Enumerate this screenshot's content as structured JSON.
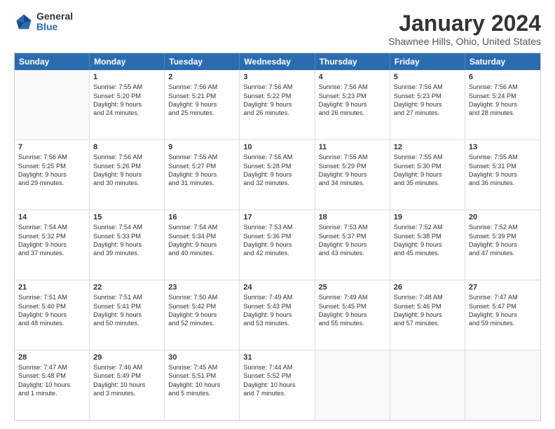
{
  "logo": {
    "general": "General",
    "blue": "Blue"
  },
  "title": "January 2024",
  "subtitle": "Shawnee Hills, Ohio, United States",
  "headers": [
    "Sunday",
    "Monday",
    "Tuesday",
    "Wednesday",
    "Thursday",
    "Friday",
    "Saturday"
  ],
  "weeks": [
    [
      {
        "day": "",
        "lines": []
      },
      {
        "day": "1",
        "lines": [
          "Sunrise: 7:55 AM",
          "Sunset: 5:20 PM",
          "Daylight: 9 hours",
          "and 24 minutes."
        ]
      },
      {
        "day": "2",
        "lines": [
          "Sunrise: 7:56 AM",
          "Sunset: 5:21 PM",
          "Daylight: 9 hours",
          "and 25 minutes."
        ]
      },
      {
        "day": "3",
        "lines": [
          "Sunrise: 7:56 AM",
          "Sunset: 5:22 PM",
          "Daylight: 9 hours",
          "and 26 minutes."
        ]
      },
      {
        "day": "4",
        "lines": [
          "Sunrise: 7:56 AM",
          "Sunset: 5:23 PM",
          "Daylight: 9 hours",
          "and 26 minutes."
        ]
      },
      {
        "day": "5",
        "lines": [
          "Sunrise: 7:56 AM",
          "Sunset: 5:23 PM",
          "Daylight: 9 hours",
          "and 27 minutes."
        ]
      },
      {
        "day": "6",
        "lines": [
          "Sunrise: 7:56 AM",
          "Sunset: 5:24 PM",
          "Daylight: 9 hours",
          "and 28 minutes."
        ]
      }
    ],
    [
      {
        "day": "7",
        "lines": [
          "Sunrise: 7:56 AM",
          "Sunset: 5:25 PM",
          "Daylight: 9 hours",
          "and 29 minutes."
        ]
      },
      {
        "day": "8",
        "lines": [
          "Sunrise: 7:56 AM",
          "Sunset: 5:26 PM",
          "Daylight: 9 hours",
          "and 30 minutes."
        ]
      },
      {
        "day": "9",
        "lines": [
          "Sunrise: 7:55 AM",
          "Sunset: 5:27 PM",
          "Daylight: 9 hours",
          "and 31 minutes."
        ]
      },
      {
        "day": "10",
        "lines": [
          "Sunrise: 7:55 AM",
          "Sunset: 5:28 PM",
          "Daylight: 9 hours",
          "and 32 minutes."
        ]
      },
      {
        "day": "11",
        "lines": [
          "Sunrise: 7:55 AM",
          "Sunset: 5:29 PM",
          "Daylight: 9 hours",
          "and 34 minutes."
        ]
      },
      {
        "day": "12",
        "lines": [
          "Sunrise: 7:55 AM",
          "Sunset: 5:30 PM",
          "Daylight: 9 hours",
          "and 35 minutes."
        ]
      },
      {
        "day": "13",
        "lines": [
          "Sunrise: 7:55 AM",
          "Sunset: 5:31 PM",
          "Daylight: 9 hours",
          "and 36 minutes."
        ]
      }
    ],
    [
      {
        "day": "14",
        "lines": [
          "Sunrise: 7:54 AM",
          "Sunset: 5:32 PM",
          "Daylight: 9 hours",
          "and 37 minutes."
        ]
      },
      {
        "day": "15",
        "lines": [
          "Sunrise: 7:54 AM",
          "Sunset: 5:33 PM",
          "Daylight: 9 hours",
          "and 39 minutes."
        ]
      },
      {
        "day": "16",
        "lines": [
          "Sunrise: 7:54 AM",
          "Sunset: 5:34 PM",
          "Daylight: 9 hours",
          "and 40 minutes."
        ]
      },
      {
        "day": "17",
        "lines": [
          "Sunrise: 7:53 AM",
          "Sunset: 5:36 PM",
          "Daylight: 9 hours",
          "and 42 minutes."
        ]
      },
      {
        "day": "18",
        "lines": [
          "Sunrise: 7:53 AM",
          "Sunset: 5:37 PM",
          "Daylight: 9 hours",
          "and 43 minutes."
        ]
      },
      {
        "day": "19",
        "lines": [
          "Sunrise: 7:52 AM",
          "Sunset: 5:38 PM",
          "Daylight: 9 hours",
          "and 45 minutes."
        ]
      },
      {
        "day": "20",
        "lines": [
          "Sunrise: 7:52 AM",
          "Sunset: 5:39 PM",
          "Daylight: 9 hours",
          "and 47 minutes."
        ]
      }
    ],
    [
      {
        "day": "21",
        "lines": [
          "Sunrise: 7:51 AM",
          "Sunset: 5:40 PM",
          "Daylight: 9 hours",
          "and 48 minutes."
        ]
      },
      {
        "day": "22",
        "lines": [
          "Sunrise: 7:51 AM",
          "Sunset: 5:41 PM",
          "Daylight: 9 hours",
          "and 50 minutes."
        ]
      },
      {
        "day": "23",
        "lines": [
          "Sunrise: 7:50 AM",
          "Sunset: 5:42 PM",
          "Daylight: 9 hours",
          "and 52 minutes."
        ]
      },
      {
        "day": "24",
        "lines": [
          "Sunrise: 7:49 AM",
          "Sunset: 5:43 PM",
          "Daylight: 9 hours",
          "and 53 minutes."
        ]
      },
      {
        "day": "25",
        "lines": [
          "Sunrise: 7:49 AM",
          "Sunset: 5:45 PM",
          "Daylight: 9 hours",
          "and 55 minutes."
        ]
      },
      {
        "day": "26",
        "lines": [
          "Sunrise: 7:48 AM",
          "Sunset: 5:46 PM",
          "Daylight: 9 hours",
          "and 57 minutes."
        ]
      },
      {
        "day": "27",
        "lines": [
          "Sunrise: 7:47 AM",
          "Sunset: 5:47 PM",
          "Daylight: 9 hours",
          "and 59 minutes."
        ]
      }
    ],
    [
      {
        "day": "28",
        "lines": [
          "Sunrise: 7:47 AM",
          "Sunset: 5:48 PM",
          "Daylight: 10 hours",
          "and 1 minute."
        ]
      },
      {
        "day": "29",
        "lines": [
          "Sunrise: 7:46 AM",
          "Sunset: 5:49 PM",
          "Daylight: 10 hours",
          "and 3 minutes."
        ]
      },
      {
        "day": "30",
        "lines": [
          "Sunrise: 7:45 AM",
          "Sunset: 5:51 PM",
          "Daylight: 10 hours",
          "and 5 minutes."
        ]
      },
      {
        "day": "31",
        "lines": [
          "Sunrise: 7:44 AM",
          "Sunset: 5:52 PM",
          "Daylight: 10 hours",
          "and 7 minutes."
        ]
      },
      {
        "day": "",
        "lines": []
      },
      {
        "day": "",
        "lines": []
      },
      {
        "day": "",
        "lines": []
      }
    ]
  ]
}
